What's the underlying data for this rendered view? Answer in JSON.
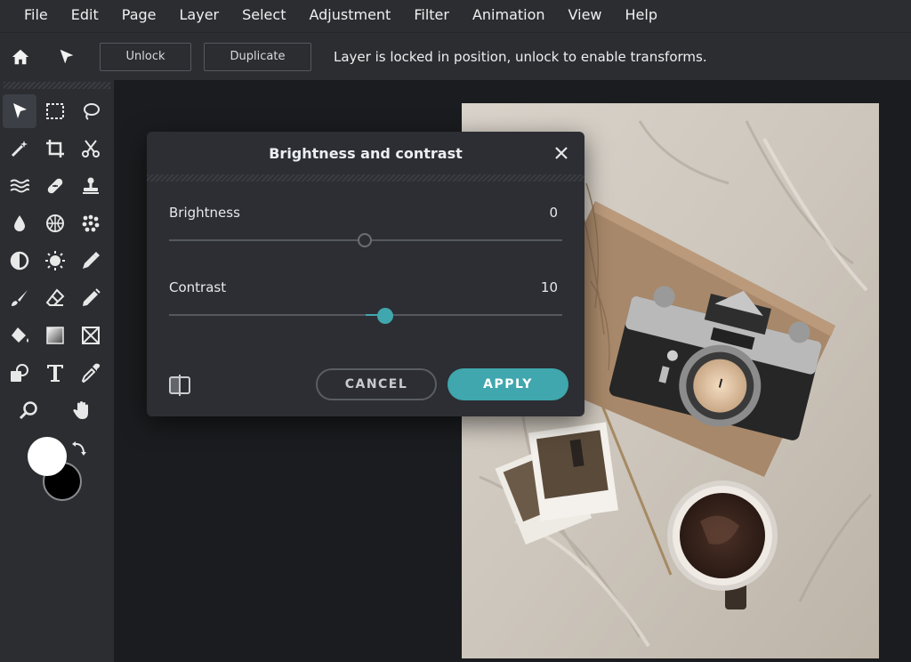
{
  "menu": [
    "File",
    "Edit",
    "Page",
    "Layer",
    "Select",
    "Adjustment",
    "Filter",
    "Animation",
    "View",
    "Help"
  ],
  "options": {
    "unlock_label": "Unlock",
    "duplicate_label": "Duplicate",
    "message": "Layer is locked in position, unlock to enable transforms."
  },
  "tools": [
    "arrange",
    "rectangle-select",
    "lasso-select",
    "magic-wand",
    "crop",
    "cut",
    "liquify",
    "heal",
    "clone-stamp",
    "blur",
    "sponge",
    "pixelate",
    "dodge-burn",
    "sharpen",
    "color-picker",
    "brush",
    "eraser",
    "pencil",
    "paint-bucket",
    "gradient",
    "drawing-shape",
    "shape",
    "text",
    "eyedropper",
    "zoom",
    "hand"
  ],
  "colors": {
    "foreground": "#ffffff",
    "background": "#000000",
    "accent": "#3fa7ad"
  },
  "dialog": {
    "title": "Brightness and contrast",
    "brightness_label": "Brightness",
    "brightness_value": "0",
    "contrast_label": "Contrast",
    "contrast_value": "10",
    "cancel_label": "CANCEL",
    "apply_label": "APPLY"
  }
}
